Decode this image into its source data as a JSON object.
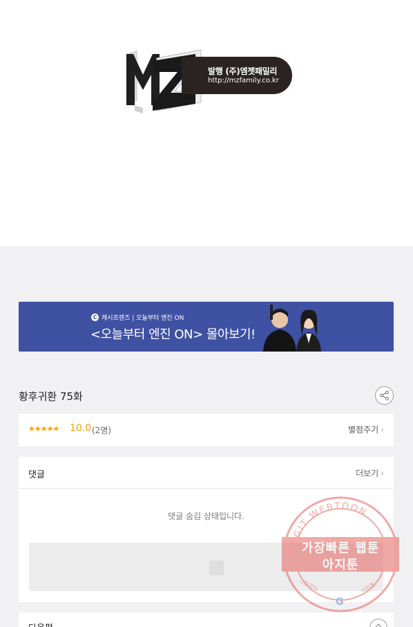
{
  "publisher": {
    "logo_mark": "MZ",
    "line1": "발행 (주)엠젯패밀리",
    "line2": "http://mzfamily.co.kr"
  },
  "banner": {
    "small": "캐시프렌즈 | 오늘부터 엔진 ON",
    "big": "<오늘부터 엔진 ON> 몰아보기!",
    "brand_color": "#3f51a3"
  },
  "episode": {
    "title": "황후귀환 75화",
    "share_icon": "share-icon"
  },
  "rating": {
    "stars": "★★★★★",
    "score": "10.0",
    "count": "(2명)",
    "rate_label": "별점주기",
    "accent": "#f5a000"
  },
  "comments": {
    "title": "댓글",
    "more_label": "더보기",
    "hidden_notice": "댓글 숨김 상태입니다."
  },
  "next": {
    "title": "다음편"
  },
  "watermark": {
    "arc_text": "AGIT WEBTOON",
    "line1": "가장빠른 웹툰",
    "line2": "아지툰",
    "small_left": "그림감지",
    "small_right": "아지툰",
    "color": "#e5645f"
  }
}
